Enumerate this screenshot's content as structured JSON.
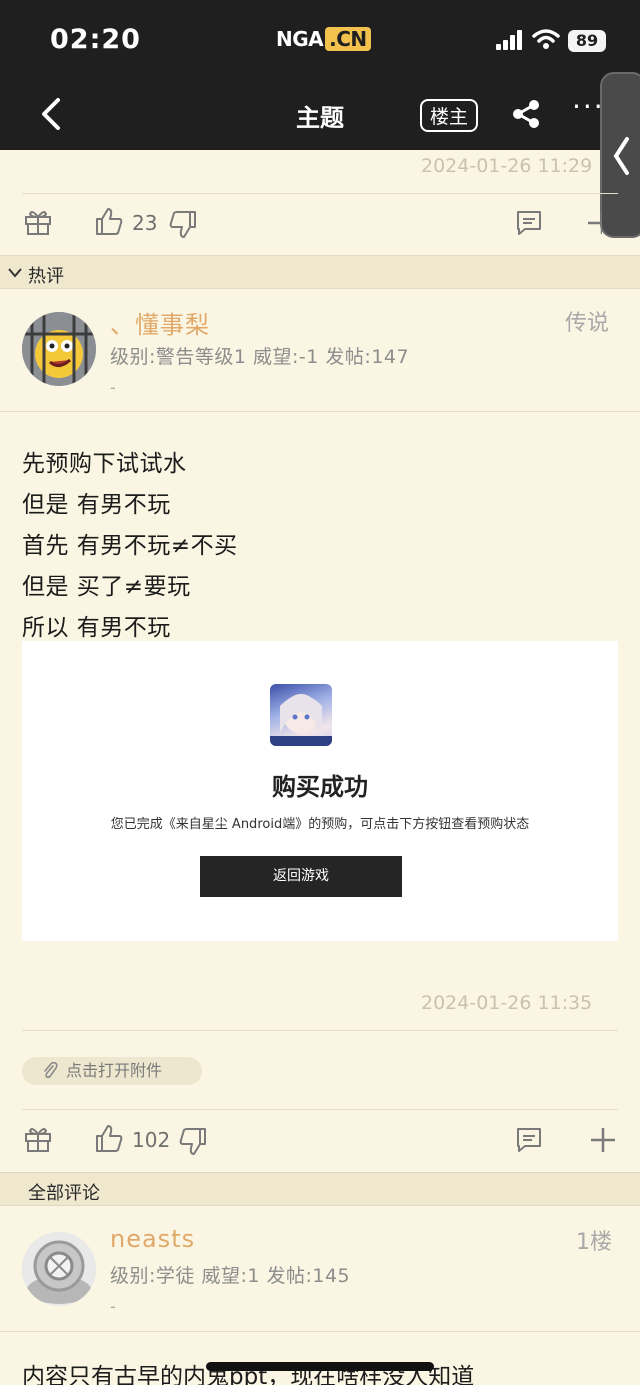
{
  "status_bar": {
    "time": "02:20",
    "app_logo": "NGA",
    "app_logo_suffix": ".CN",
    "battery": "89"
  },
  "nav": {
    "title": "主题",
    "owner_button": "楼主"
  },
  "prev_post": {
    "date": "2024-01-26 11:29",
    "like_count": "23"
  },
  "hot_section": {
    "label": "热评"
  },
  "hot_post": {
    "username": "、懂事梨",
    "rank": "传说",
    "info": "级别:警告等级1  威望:-1  发帖:147",
    "signature": "-",
    "lines": [
      "先预购下试试水",
      "但是 有男不玩",
      "首先 有男不玩≠不买",
      "但是 买了≠要玩",
      "所以 有男不玩"
    ],
    "embed": {
      "success_title": "购买成功",
      "description": "您已完成《来自星尘 Android端》的预购，可点击下方按钮查看预购状态",
      "button": "返回游戏"
    },
    "date": "2024-01-26 11:35",
    "attachment": "点击打开附件",
    "like_count": "102"
  },
  "all_section": {
    "label": "全部评论"
  },
  "comment": {
    "username": "neasts",
    "floor": "1楼",
    "info": "级别:学徒  威望:1  发帖:145",
    "signature": "-",
    "text": "内容只有古早的内鬼ppt，现在啥样没人知道"
  },
  "colors": {
    "background": "#fbf6e3",
    "header": "#1f1f1f",
    "username": "#e0a96a",
    "section_bar": "#efe8cf"
  }
}
